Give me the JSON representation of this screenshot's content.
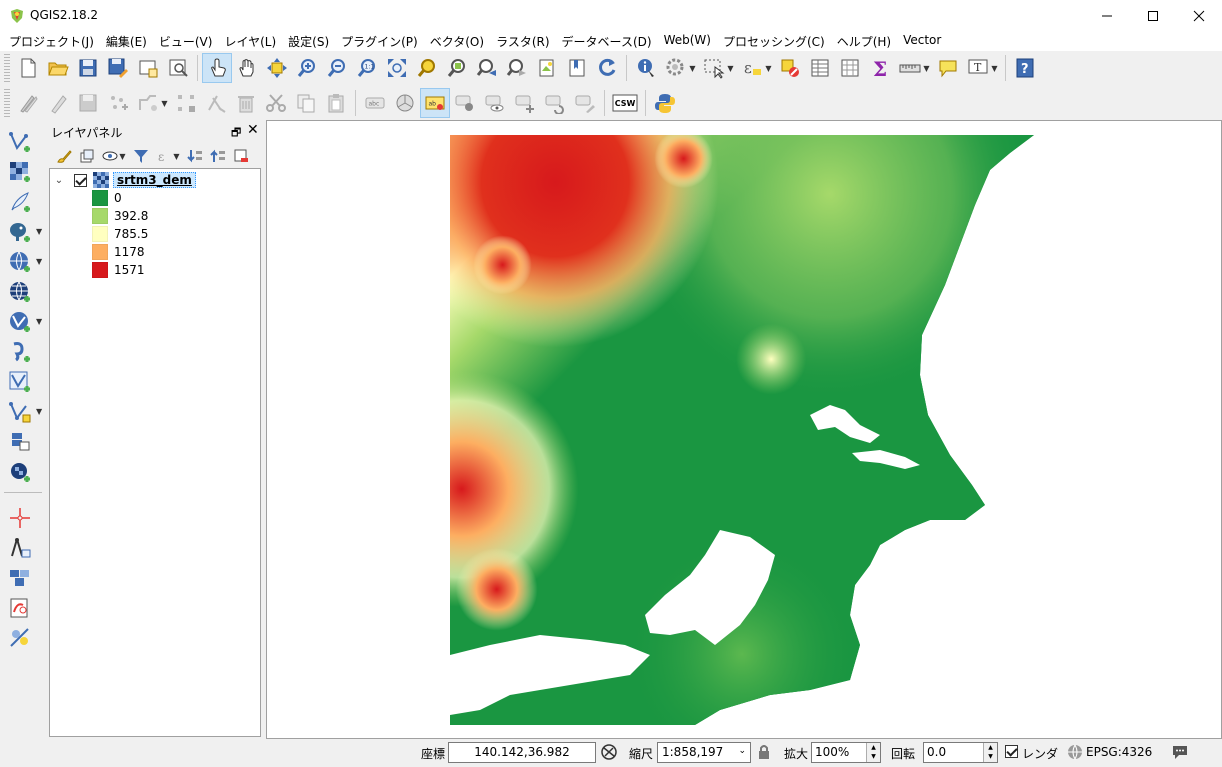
{
  "window": {
    "title": "QGIS2.18.2",
    "minimize_glyph": "minimize-icon",
    "maximize_glyph": "maximize-icon",
    "close_glyph": "close-icon"
  },
  "menu": [
    {
      "label": "プロジェクト(J)"
    },
    {
      "label": "編集(E)"
    },
    {
      "label": "ビュー(V)"
    },
    {
      "label": "レイヤ(L)"
    },
    {
      "label": "設定(S)"
    },
    {
      "label": "プラグイン(P)"
    },
    {
      "label": "ベクタ(O)"
    },
    {
      "label": "ラスタ(R)"
    },
    {
      "label": "データベース(D)"
    },
    {
      "label": "Web(W)"
    },
    {
      "label": "プロセッシング(C)"
    },
    {
      "label": "ヘルプ(H)"
    },
    {
      "label": "Vector"
    }
  ],
  "toolbar2": {
    "csw_label": "CSW"
  },
  "layer_panel": {
    "title": "レイヤパネル",
    "layer": {
      "name": "srtm3_dem",
      "checked": true
    },
    "legend": [
      {
        "label": "0",
        "color": "#1a9641"
      },
      {
        "label": "392.8",
        "color": "#a6d96a"
      },
      {
        "label": "785.5",
        "color": "#ffffc0"
      },
      {
        "label": "1178",
        "color": "#fdae61"
      },
      {
        "label": "1571",
        "color": "#d7191c"
      }
    ]
  },
  "statusbar": {
    "coord_label": "座標",
    "coord_value": "140.142,36.982",
    "scale_label": "縮尺",
    "scale_value": "1:858,197",
    "magnifier_label": "拡大",
    "magnifier_value": "100%",
    "rotation_label": "回転",
    "rotation_value": "0.0",
    "render_label": "レンダ",
    "render_checked": true,
    "crs_label": "EPSG:4326"
  }
}
